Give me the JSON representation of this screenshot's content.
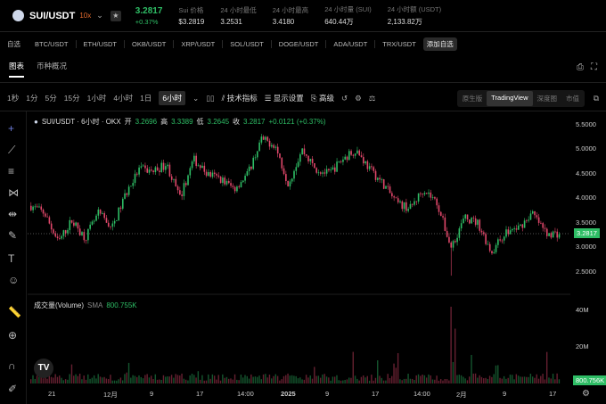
{
  "header": {
    "pair": "SUI/USDT",
    "leverage": "10x",
    "last_price": "3.2817",
    "change": "+0.37%",
    "stats": [
      {
        "label": "Sui 价格",
        "value": "$3.2819"
      },
      {
        "label": "24 小时最低",
        "value": "3.2531"
      },
      {
        "label": "24 小时最高",
        "value": "3.4180"
      },
      {
        "label": "24 小时量 (SUI)",
        "value": "640.44万"
      },
      {
        "label": "24 小时额 (USDT)",
        "value": "2,133.82万"
      }
    ]
  },
  "favorites": {
    "label": "自选",
    "items": [
      "BTC/USDT",
      "ETH/USDT",
      "OKB/USDT",
      "XRP/USDT",
      "SOL/USDT",
      "DOGE/USDT",
      "ADA/USDT",
      "TRX/USDT"
    ],
    "add": "添加自选"
  },
  "tabs": [
    "图表",
    "币种概况"
  ],
  "toolbar": {
    "intervals": [
      "1秒",
      "1分",
      "5分",
      "15分",
      "1小时",
      "4小时",
      "1日",
      "6小时"
    ],
    "indicators": "技术指标",
    "display": "显示设置",
    "advanced": "高级",
    "views": [
      "原生版",
      "TradingView",
      "深度图",
      "市值"
    ]
  },
  "legend": {
    "title": "SUI/USDT · 6小时 · OKX",
    "open_l": "开",
    "open": "3.2696",
    "high_l": "高",
    "high": "3.3389",
    "low_l": "低",
    "low": "3.2645",
    "close_l": "收",
    "close": "3.2817",
    "chg": "+0.0121 (+0.37%)"
  },
  "volume": {
    "title": "成交量(Volume)",
    "sma": "SMA",
    "value": "800.755K"
  },
  "price_axis": [
    "5.5000",
    "5.0000",
    "4.5000",
    "4.0000",
    "3.5000",
    "3.0000",
    "2.5000"
  ],
  "volume_axis": [
    "40M",
    "20M"
  ],
  "current_tag": "3.2817",
  "volume_tag": "800.756K",
  "time_axis": [
    "21",
    "12月",
    "9",
    "17",
    "14:00",
    "2025",
    "9",
    "17",
    "14:00",
    "2月",
    "9",
    "17"
  ],
  "colors": {
    "up": "#2ebd65",
    "down": "#e0476a"
  },
  "chart_data": {
    "type": "candlestick",
    "ylim": [
      2.2,
      5.7
    ],
    "close_trend": [
      3.85,
      3.7,
      3.1,
      3.55,
      3.2,
      3.7,
      3.4,
      4.1,
      4.6,
      4.55,
      4.7,
      4.0,
      4.8,
      4.5,
      4.4,
      4.2,
      4.5,
      5.2,
      5.1,
      4.3,
      5.0,
      4.6,
      4.5,
      4.8,
      5.0,
      4.6,
      4.3,
      3.9,
      3.8,
      4.2,
      3.9,
      3.0,
      3.6,
      3.5,
      2.9,
      3.3,
      3.4,
      3.7,
      3.3,
      3.28
    ]
  }
}
